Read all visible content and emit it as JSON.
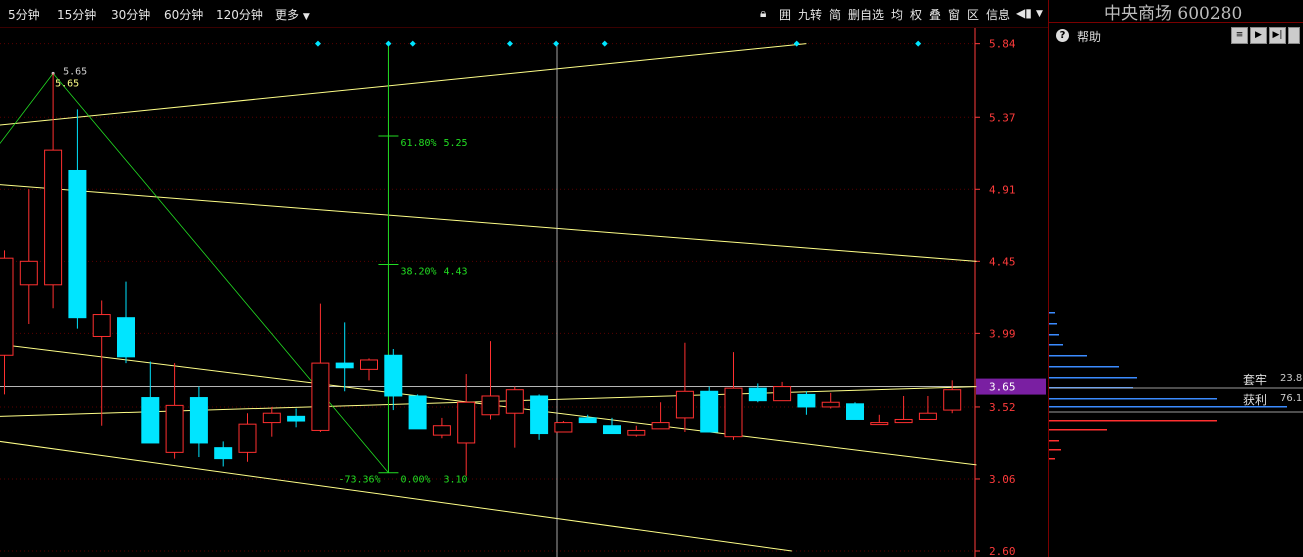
{
  "toolbar": {
    "periods": [
      "5分钟",
      "15分钟",
      "30分钟",
      "60分钟",
      "120分钟",
      "更多"
    ],
    "tools": [
      "囲",
      "九转",
      "简",
      "删自选",
      "均",
      "权",
      "叠",
      "窗",
      "区",
      "信息"
    ]
  },
  "sidebar": {
    "title": "中央商场  600280",
    "help": "帮助",
    "trapped_label": "套牢",
    "trapped_value": "23.8",
    "profit_label": "获利",
    "profit_value": "76.1"
  },
  "colors": {
    "up": "#ff3030",
    "down": "#00e5ff",
    "fib": "#22dd22",
    "trend": "#ffff88",
    "axis": "#ff3b3b",
    "current_price_bg": "#7a1fa2",
    "volume_profile_blue": "#3b8bff",
    "volume_profile_red": "#ff3030"
  },
  "chart_data": {
    "type": "candlestick",
    "ylim": [
      2.6,
      5.94
    ],
    "y_ticks": [
      "5.84",
      "5.37",
      "4.91",
      "4.45",
      "3.99",
      "3.52",
      "3.06",
      "2.60"
    ],
    "current_price": "3.65",
    "high_marker": "5.65",
    "high_marker_sub": "5.65",
    "fib_labels": [
      {
        "pct": "61.80%",
        "price": "5.25"
      },
      {
        "pct": "38.20%",
        "price": "4.43"
      },
      {
        "pct": "0.00%",
        "price": "3.10"
      }
    ],
    "fib_left_label": "-73.36%",
    "fib_level_values": [
      5.25,
      4.43,
      3.1
    ],
    "candles": [
      {
        "o": 3.85,
        "h": 4.52,
        "l": 3.6,
        "c": 4.47
      },
      {
        "o": 4.3,
        "h": 4.91,
        "l": 4.05,
        "c": 4.45
      },
      {
        "o": 4.3,
        "h": 5.65,
        "l": 4.15,
        "c": 5.16
      },
      {
        "o": 5.03,
        "h": 5.42,
        "l": 4.02,
        "c": 4.09
      },
      {
        "o": 3.97,
        "h": 4.2,
        "l": 3.4,
        "c": 4.11
      },
      {
        "o": 4.09,
        "h": 4.32,
        "l": 3.8,
        "c": 3.84
      },
      {
        "o": 3.58,
        "h": 3.81,
        "l": 3.3,
        "c": 3.29
      },
      {
        "o": 3.23,
        "h": 3.8,
        "l": 3.19,
        "c": 3.53
      },
      {
        "o": 3.58,
        "h": 3.65,
        "l": 3.2,
        "c": 3.29
      },
      {
        "o": 3.26,
        "h": 3.3,
        "l": 3.14,
        "c": 3.19
      },
      {
        "o": 3.23,
        "h": 3.48,
        "l": 3.17,
        "c": 3.41
      },
      {
        "o": 3.42,
        "h": 3.52,
        "l": 3.33,
        "c": 3.48
      },
      {
        "o": 3.46,
        "h": 3.51,
        "l": 3.39,
        "c": 3.43
      },
      {
        "o": 3.37,
        "h": 4.18,
        "l": 3.36,
        "c": 3.8
      },
      {
        "o": 3.8,
        "h": 4.06,
        "l": 3.62,
        "c": 3.77
      },
      {
        "o": 3.76,
        "h": 3.83,
        "l": 3.69,
        "c": 3.82
      },
      {
        "o": 3.85,
        "h": 3.89,
        "l": 3.5,
        "c": 3.59
      },
      {
        "o": 3.59,
        "h": 3.6,
        "l": 3.38,
        "c": 3.38
      },
      {
        "o": 3.34,
        "h": 3.45,
        "l": 3.32,
        "c": 3.4
      },
      {
        "o": 3.29,
        "h": 3.73,
        "l": 3.08,
        "c": 3.55
      },
      {
        "o": 3.47,
        "h": 3.94,
        "l": 3.44,
        "c": 3.59
      },
      {
        "o": 3.48,
        "h": 3.65,
        "l": 3.26,
        "c": 3.63
      },
      {
        "o": 3.59,
        "h": 3.6,
        "l": 3.31,
        "c": 3.35
      },
      {
        "o": 3.36,
        "h": 3.43,
        "l": 3.36,
        "c": 3.42
      },
      {
        "o": 3.45,
        "h": 3.47,
        "l": 3.42,
        "c": 3.42
      },
      {
        "o": 3.4,
        "h": 3.45,
        "l": 3.35,
        "c": 3.35
      },
      {
        "o": 3.34,
        "h": 3.4,
        "l": 3.33,
        "c": 3.37
      },
      {
        "o": 3.38,
        "h": 3.55,
        "l": 3.38,
        "c": 3.42
      },
      {
        "o": 3.45,
        "h": 3.93,
        "l": 3.36,
        "c": 3.62
      },
      {
        "o": 3.62,
        "h": 3.65,
        "l": 3.36,
        "c": 3.36
      },
      {
        "o": 3.33,
        "h": 3.87,
        "l": 3.31,
        "c": 3.64
      },
      {
        "o": 3.64,
        "h": 3.67,
        "l": 3.55,
        "c": 3.56
      },
      {
        "o": 3.56,
        "h": 3.68,
        "l": 3.57,
        "c": 3.65
      },
      {
        "o": 3.6,
        "h": 3.62,
        "l": 3.47,
        "c": 3.52
      },
      {
        "o": 3.52,
        "h": 3.61,
        "l": 3.51,
        "c": 3.55
      },
      {
        "o": 3.54,
        "h": 3.55,
        "l": 3.44,
        "c": 3.44
      },
      {
        "o": 3.42,
        "h": 3.47,
        "l": 3.41,
        "c": 3.42
      },
      {
        "o": 3.42,
        "h": 3.59,
        "l": 3.42,
        "c": 3.44
      },
      {
        "o": 3.44,
        "h": 3.59,
        "l": 3.44,
        "c": 3.48
      },
      {
        "o": 3.5,
        "h": 3.69,
        "l": 3.48,
        "c": 3.63
      }
    ]
  }
}
